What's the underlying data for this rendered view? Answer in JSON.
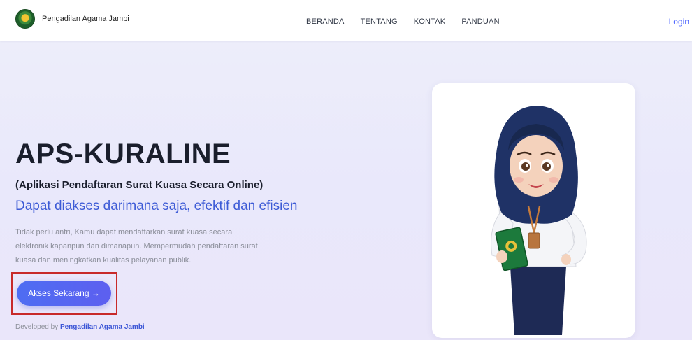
{
  "header": {
    "brand": "Pengadilan Agama Jambi",
    "nav": [
      "BERANDA",
      "TENTANG",
      "KONTAK",
      "PANDUAN"
    ],
    "login": "Login"
  },
  "hero": {
    "title": "APS-KURALINE",
    "subtitle": "(Aplikasi Pendaftaran Surat Kuasa Secara Online)",
    "tagline": "Dapat diakses darimana saja, efektif dan efisien",
    "description": "Tidak perlu antri, Kamu dapat mendaftarkan surat kuasa secara elektronik kapanpun dan dimanapun. Mempermudah pendaftaran surat kuasa dan meningkatkan kualitas pelayanan publik.",
    "cta_label": "Akses Sekarang →"
  },
  "footer": {
    "developed_prefix": "Developed by ",
    "developed_by": "Pengadilan Agama Jambi"
  },
  "colors": {
    "accent": "#4e6df2",
    "highlight_box": "#c82a2a",
    "tagline": "#3d5bd6"
  },
  "icons": {
    "logo": "court-emblem-icon",
    "illustration": "hijab-woman-illustration"
  }
}
